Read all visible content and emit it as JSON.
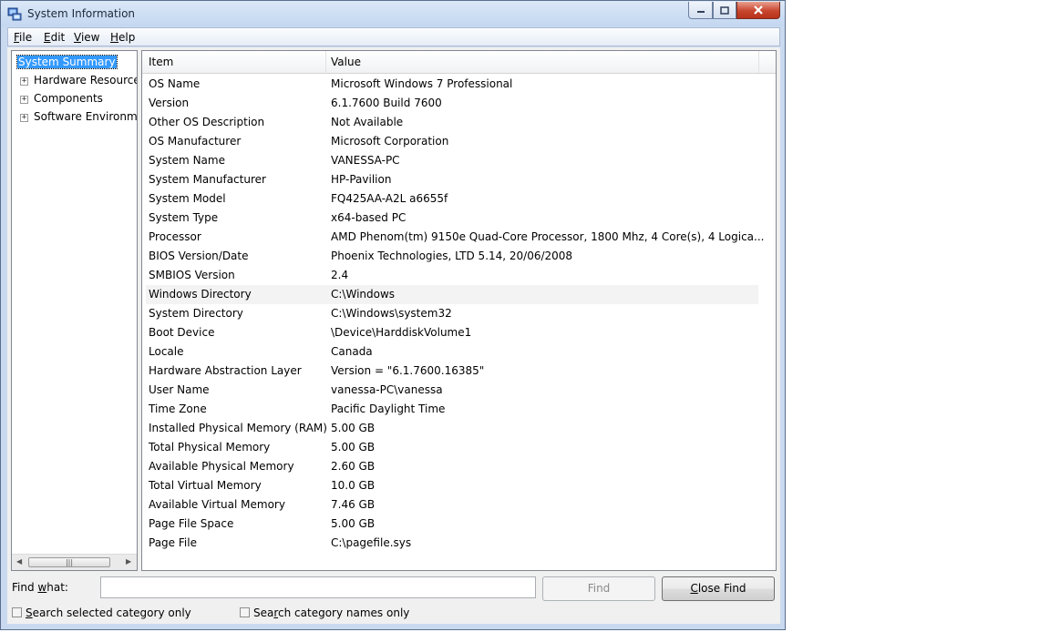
{
  "window": {
    "title": "System Information"
  },
  "menu": [
    {
      "accel": "F",
      "rest": "ile"
    },
    {
      "accel": "E",
      "rest": "dit"
    },
    {
      "accel": "V",
      "rest": "iew"
    },
    {
      "accel": "H",
      "rest": "elp"
    }
  ],
  "tree": {
    "selected": "System Summary",
    "items": [
      "Hardware Resources",
      "Components",
      "Software Environment"
    ]
  },
  "grid": {
    "columns": {
      "item": "Item",
      "value": "Value"
    },
    "rows": [
      {
        "item": "OS Name",
        "value": "Microsoft Windows 7 Professional"
      },
      {
        "item": "Version",
        "value": "6.1.7600 Build 7600"
      },
      {
        "item": "Other OS Description",
        "value": "Not Available"
      },
      {
        "item": "OS Manufacturer",
        "value": "Microsoft Corporation"
      },
      {
        "item": "System Name",
        "value": "VANESSA-PC"
      },
      {
        "item": "System Manufacturer",
        "value": "HP-Pavilion"
      },
      {
        "item": "System Model",
        "value": "FQ425AA-A2L a6655f"
      },
      {
        "item": "System Type",
        "value": "x64-based PC"
      },
      {
        "item": "Processor",
        "value": "AMD Phenom(tm) 9150e Quad-Core Processor, 1800 Mhz, 4 Core(s), 4 Logica..."
      },
      {
        "item": "BIOS Version/Date",
        "value": "Phoenix Technologies, LTD 5.14, 20/06/2008"
      },
      {
        "item": "SMBIOS Version",
        "value": "2.4"
      },
      {
        "item": "Windows Directory",
        "value": "C:\\Windows"
      },
      {
        "item": "System Directory",
        "value": "C:\\Windows\\system32"
      },
      {
        "item": "Boot Device",
        "value": "\\Device\\HarddiskVolume1"
      },
      {
        "item": "Locale",
        "value": "Canada"
      },
      {
        "item": "Hardware Abstraction Layer",
        "value": "Version = \"6.1.7600.16385\""
      },
      {
        "item": "User Name",
        "value": "vanessa-PC\\vanessa"
      },
      {
        "item": "Time Zone",
        "value": "Pacific Daylight Time"
      },
      {
        "item": "Installed Physical Memory (RAM)",
        "value": "5.00 GB"
      },
      {
        "item": "Total Physical Memory",
        "value": "5.00 GB"
      },
      {
        "item": "Available Physical Memory",
        "value": "2.60 GB"
      },
      {
        "item": "Total Virtual Memory",
        "value": "10.0 GB"
      },
      {
        "item": "Available Virtual Memory",
        "value": "7.46 GB"
      },
      {
        "item": "Page File Space",
        "value": "5.00 GB"
      },
      {
        "item": "Page File",
        "value": "C:\\pagefile.sys"
      }
    ]
  },
  "find": {
    "label_accel": "Find ",
    "label_u": "w",
    "label_rest": "hat:",
    "value": "",
    "find_button": "Find",
    "close_accel": "C",
    "close_rest": "lose Find",
    "search_selected": {
      "accel": "S",
      "rest": "earch selected category only"
    },
    "search_names": {
      "pre": "Sea",
      "accel": "r",
      "rest": "ch category names only"
    }
  }
}
